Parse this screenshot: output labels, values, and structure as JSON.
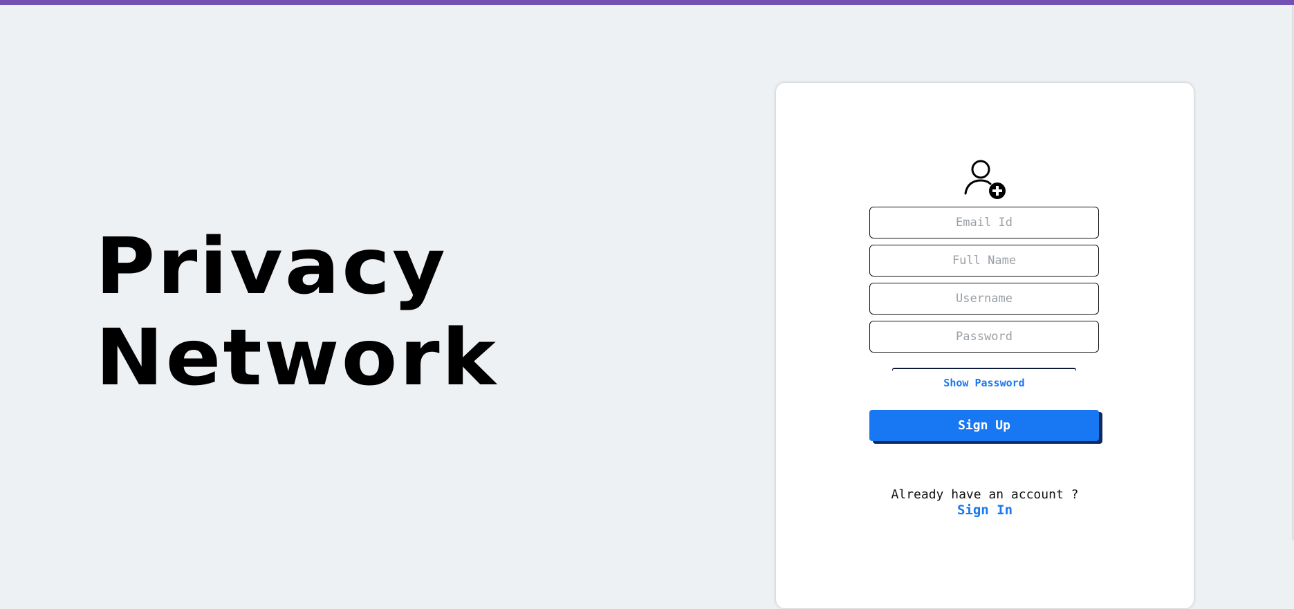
{
  "brand": {
    "line1": "Privacy",
    "line2": "Network"
  },
  "form": {
    "avatar_icon": "add-user-icon",
    "email_placeholder": "Email Id",
    "fullname_placeholder": "Full Name",
    "username_placeholder": "Username",
    "password_placeholder": "Password",
    "show_password_label": "Show Password",
    "signup_label": "Sign Up",
    "already_text": "Already have an account ?",
    "signin_label": "Sign In"
  },
  "colors": {
    "accent": "#1877f2",
    "top_bar": "#7450b5",
    "background": "#eef1f4"
  }
}
